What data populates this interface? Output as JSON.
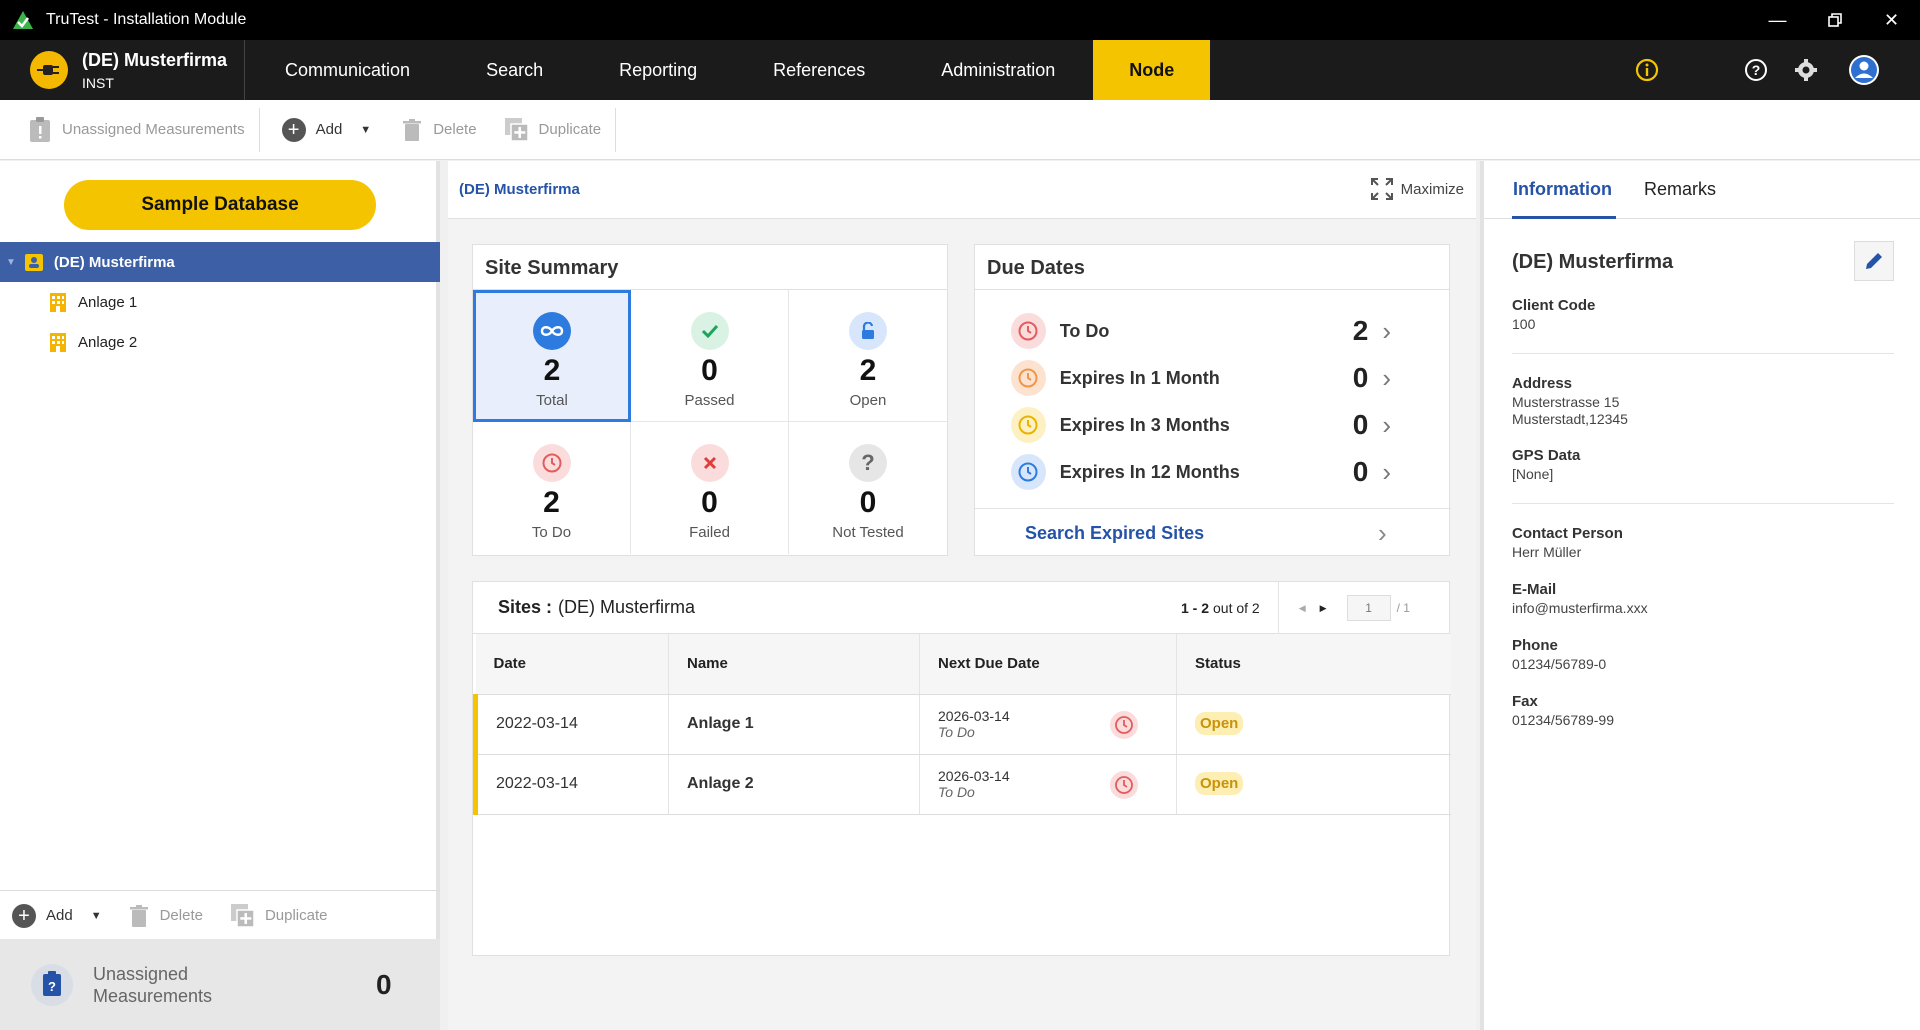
{
  "window": {
    "title": "TruTest - Installation Module"
  },
  "brand": {
    "name": "(DE) Musterfirma",
    "sub": "INST"
  },
  "menu": [
    "Communication",
    "Search",
    "Reporting",
    "References",
    "Administration",
    "Node"
  ],
  "toolbar": {
    "unassigned": "Unassigned Measurements",
    "add": "Add",
    "delete": "Delete",
    "duplicate": "Duplicate"
  },
  "left": {
    "sample_db": "Sample Database",
    "root": "(DE) Musterfirma",
    "children": [
      "Anlage 1",
      "Anlage 2"
    ],
    "bottom_add": "Add",
    "bottom_delete": "Delete",
    "bottom_duplicate": "Duplicate",
    "unassigned_label_1": "Unassigned",
    "unassigned_label_2": "Measurements",
    "unassigned_count": "0"
  },
  "center": {
    "breadcrumb": "(DE) Musterfirma",
    "maximize": "Maximize",
    "site_summary": {
      "title": "Site Summary",
      "cells": [
        {
          "num": "2",
          "label": "Total"
        },
        {
          "num": "0",
          "label": "Passed"
        },
        {
          "num": "2",
          "label": "Open"
        },
        {
          "num": "2",
          "label": "To Do"
        },
        {
          "num": "0",
          "label": "Failed"
        },
        {
          "num": "0",
          "label": "Not Tested"
        }
      ]
    },
    "due_dates": {
      "title": "Due Dates",
      "rows": [
        {
          "label": "To Do",
          "count": "2"
        },
        {
          "label": "Expires In 1 Month",
          "count": "0"
        },
        {
          "label": "Expires In 3 Months",
          "count": "0"
        },
        {
          "label": "Expires In 12 Months",
          "count": "0"
        }
      ],
      "search_expired": "Search Expired Sites"
    },
    "sites": {
      "title_prefix": "Sites :",
      "title_name": "(DE) Musterfirma",
      "range": "1 - 2",
      "out_of": "out of 2",
      "page": "1",
      "page_total": "/ 1",
      "columns": [
        "Date",
        "Name",
        "Next Due Date",
        "Status"
      ],
      "rows": [
        {
          "date": "2022-03-14",
          "name": "Anlage 1",
          "next_due": "2026-03-14",
          "next_due_sub": "To Do",
          "status": "Open"
        },
        {
          "date": "2022-03-14",
          "name": "Anlage 2",
          "next_due": "2026-03-14",
          "next_due_sub": "To Do",
          "status": "Open"
        }
      ]
    }
  },
  "right": {
    "tabs": [
      "Information",
      "Remarks"
    ],
    "name": "(DE) Musterfirma",
    "client_code_label": "Client Code",
    "client_code": "100",
    "address_label": "Address",
    "address_1": "Musterstrasse 15",
    "address_2": "Musterstadt,12345",
    "gps_label": "GPS Data",
    "gps": "[None]",
    "contact_label": "Contact Person",
    "contact": "Herr Müller",
    "email_label": "E-Mail",
    "email": "info@musterfirma.xxx",
    "phone_label": "Phone",
    "phone": "01234/56789-0",
    "fax_label": "Fax",
    "fax": "01234/56789-99"
  },
  "colors": {
    "accent": "#f5c400",
    "primary": "#2553a8",
    "tree_selected": "#3c5fa5"
  }
}
